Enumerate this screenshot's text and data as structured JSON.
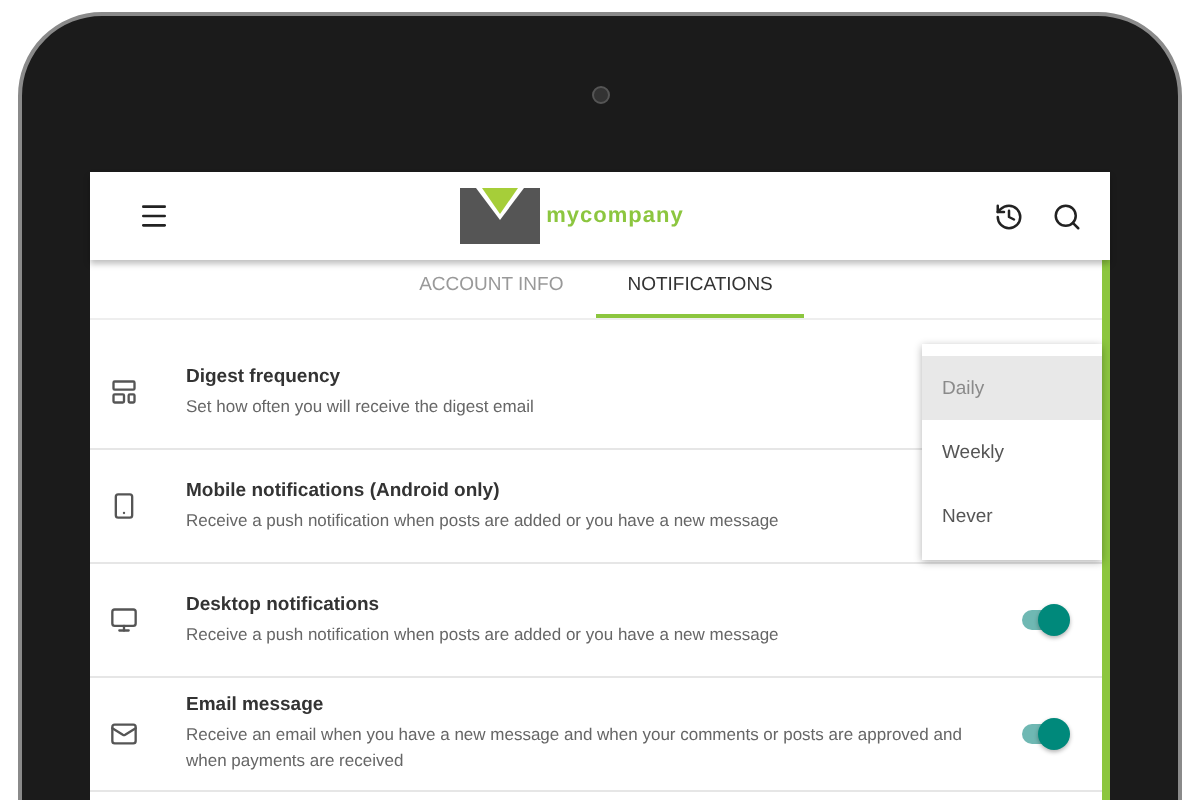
{
  "header": {
    "brand": "mycompany"
  },
  "tabs": [
    {
      "label": "ACCOUNT INFO",
      "selected": false
    },
    {
      "label": "NOTIFICATIONS",
      "selected": true
    }
  ],
  "settings": [
    {
      "kind": "select",
      "title": "Digest frequency",
      "description": "Set how often you will receive the digest email"
    },
    {
      "kind": "plain",
      "title": "Mobile notifications (Android only)",
      "description": "Receive a push notification when posts are added or you have a new message"
    },
    {
      "kind": "toggle",
      "title": "Desktop notifications",
      "description": "Receive a push notification when posts are added or you have a new message",
      "on": true
    },
    {
      "kind": "toggle",
      "title": "Email message",
      "description": "Receive an email when you have a new message and when your comments or posts are approved and when payments are received",
      "on": true
    }
  ],
  "dropdown": [
    {
      "label": "Daily",
      "selected": true
    },
    {
      "label": "Weekly",
      "selected": false
    },
    {
      "label": "Never",
      "selected": false
    }
  ]
}
